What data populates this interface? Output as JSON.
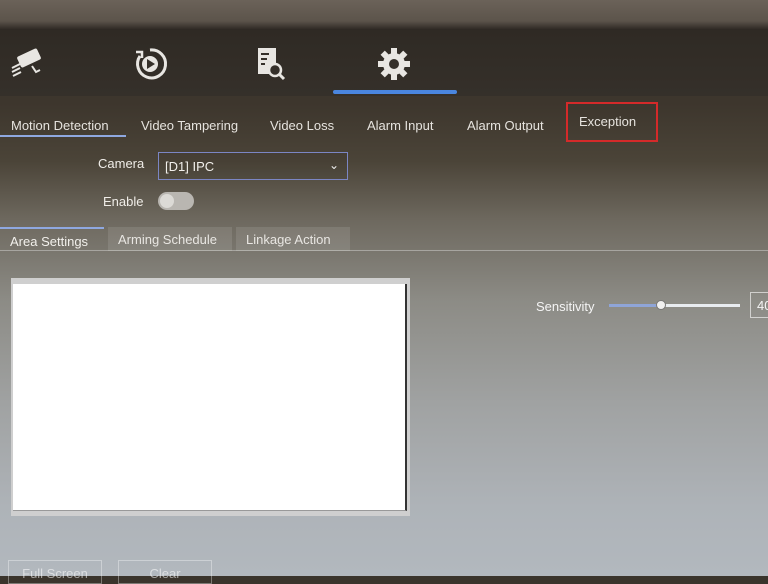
{
  "top_nav": {
    "items": [
      {
        "name": "live-view",
        "icon": "camera-icon"
      },
      {
        "name": "playback",
        "icon": "playback-icon"
      },
      {
        "name": "search",
        "icon": "file-search-icon"
      },
      {
        "name": "configuration",
        "icon": "gear-icon",
        "active": true
      }
    ],
    "accent_color": "#4a86e0"
  },
  "event_tabs": [
    {
      "label": "Motion Detection",
      "active": true
    },
    {
      "label": "Video Tampering"
    },
    {
      "label": "Video Loss"
    },
    {
      "label": "Alarm Input"
    },
    {
      "label": "Alarm Output"
    },
    {
      "label": "Exception",
      "highlighted": true
    }
  ],
  "form": {
    "camera_label": "Camera",
    "camera_value": "[D1] IPC",
    "enable_label": "Enable",
    "enable_value": false
  },
  "sub_tabs": [
    {
      "label": "Area Settings",
      "active": true
    },
    {
      "label": "Arming Schedule"
    },
    {
      "label": "Linkage Action"
    }
  ],
  "sensitivity": {
    "label": "Sensitivity",
    "value": "40",
    "fraction": 0.4
  },
  "buttons": {
    "full_screen": "Full Screen",
    "clear": "Clear"
  },
  "highlight_color": "#d42a2a"
}
